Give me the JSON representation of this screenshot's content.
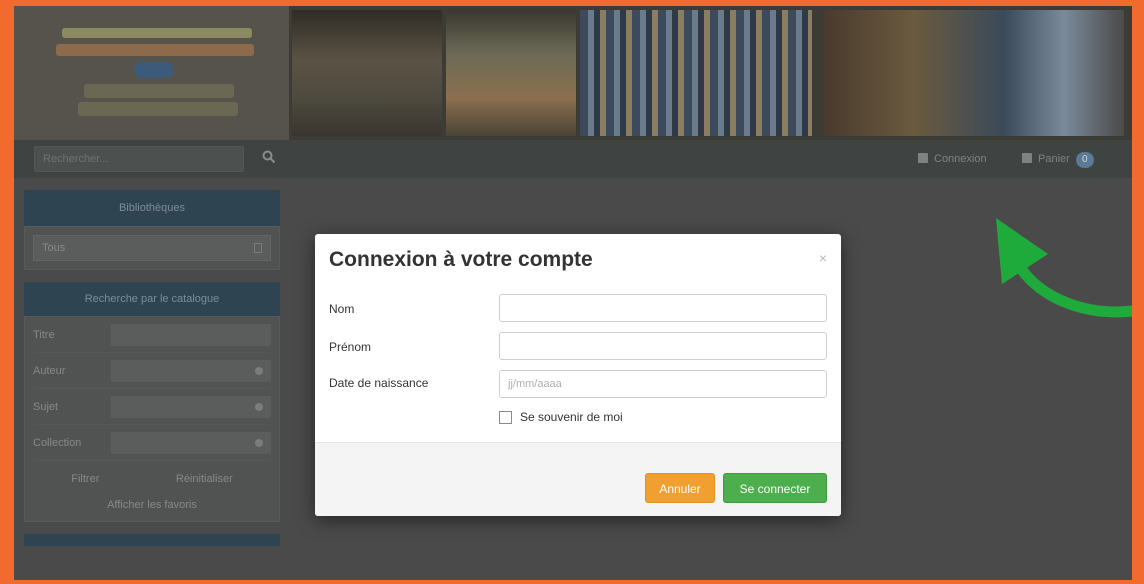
{
  "header": {
    "logo_name": "logo",
    "search": {
      "placeholder": "Rechercher...",
      "icon": "search-icon"
    },
    "nav": [
      {
        "label": "Connexion",
        "icon": "user-icon"
      },
      {
        "label": "Panier",
        "icon": "cart-icon",
        "badge": "0"
      }
    ]
  },
  "sidebar": {
    "panel1": {
      "title": "Bibliothèques",
      "select_value": "Tous"
    },
    "panel2": {
      "title": "Recherche par le catalogue",
      "rows": [
        {
          "label": "Titre"
        },
        {
          "label": "Auteur"
        },
        {
          "label": "Sujet"
        },
        {
          "label": "Collection"
        }
      ],
      "buttons": [
        "Filtrer",
        "Réinitialiser"
      ],
      "link": "Afficher les favoris"
    }
  },
  "modal": {
    "title": "Connexion à votre compte",
    "close": "×",
    "fields": [
      {
        "label": "Nom",
        "value": "",
        "placeholder": ""
      },
      {
        "label": "Prénom",
        "value": "",
        "placeholder": ""
      },
      {
        "label": "Date de naissance",
        "value": "",
        "placeholder": "jj/mm/aaaa"
      }
    ],
    "remember_label": "Se souvenir de moi",
    "cancel_label": "Annuler",
    "submit_label": "Se connecter"
  },
  "colors": {
    "frame": "#f26a2e",
    "cancel": "#f0a030",
    "submit": "#4cae4c",
    "arrow": "#1eab3c"
  }
}
